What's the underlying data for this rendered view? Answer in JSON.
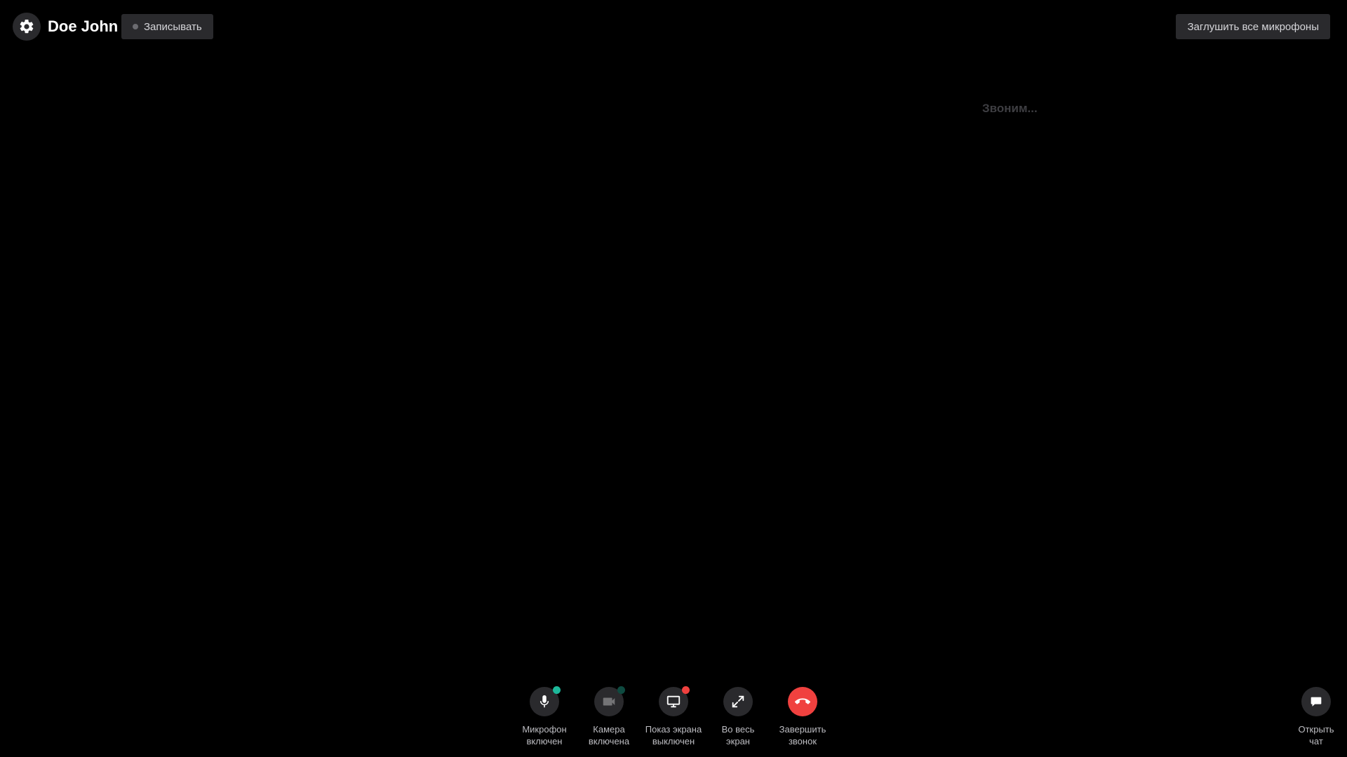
{
  "header": {
    "user_name": "Doe John",
    "record_label": "Записывать",
    "mute_all_label": "Заглушить все микрофоны",
    "settings_icon": "gear-icon"
  },
  "call": {
    "status_text": "Звоним..."
  },
  "controls": [
    {
      "id": "mic",
      "icon": "microphone-icon",
      "label": "Микрофон\nвключен",
      "badge_color": "#1db89a",
      "enabled": true
    },
    {
      "id": "camera",
      "icon": "video-camera-icon",
      "label": "Камера\nвключена",
      "badge_color": "#0e4a40",
      "enabled": false
    },
    {
      "id": "screen",
      "icon": "monitor-icon",
      "label": "Показ экрана\nвыключен",
      "badge_color": "#f0413f",
      "enabled": true
    },
    {
      "id": "fullscreen",
      "icon": "expand-icon",
      "label": "Во весь\nэкран",
      "enabled": true
    },
    {
      "id": "end-call",
      "icon": "phone-hangup-icon",
      "label": "Завершить\nзвонок",
      "enabled": true
    }
  ],
  "chat": {
    "icon": "chat-bubble-icon",
    "label": "Открыть\nчат"
  },
  "colors": {
    "background": "#000000",
    "button_bg": "#2a2a2d",
    "end_call": "#f0413f",
    "status_on": "#1db89a",
    "status_off": "#f0413f"
  }
}
